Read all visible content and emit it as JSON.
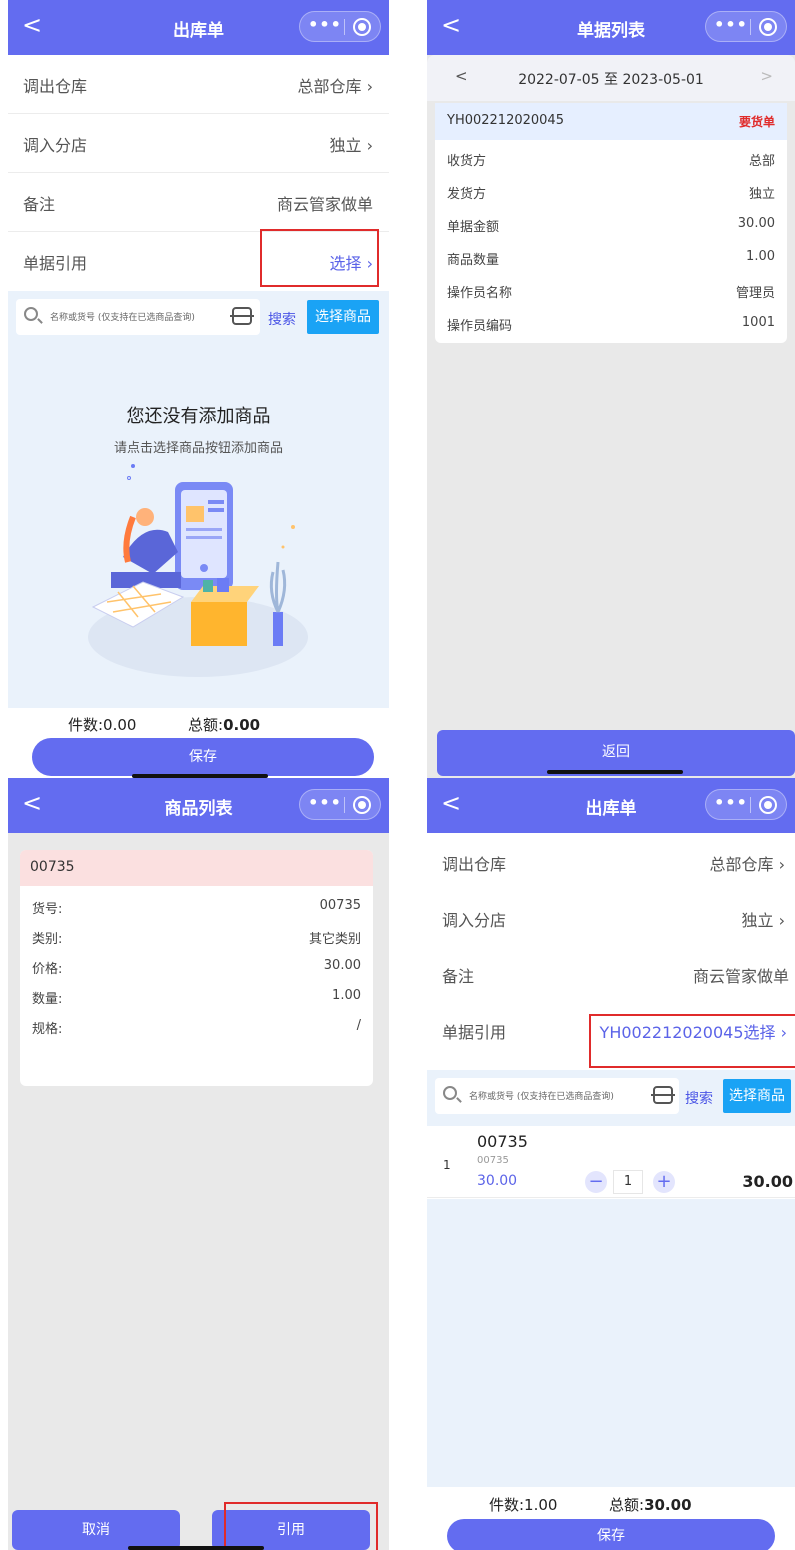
{
  "common": {
    "back_glyph": "<",
    "capsule_dots": "•••",
    "arrow": "›",
    "search_placeholder": "名称或货号 (仅支持在已选商品查询)",
    "search_label": "搜索",
    "pick_goods_label": "选择商品",
    "save_label": "保存",
    "accent_color": "#636cf0",
    "pick_color": "#1aa3f5",
    "highlight_box_color": "#e02b2b"
  },
  "outbound_empty": {
    "title": "出库单",
    "rows": [
      {
        "label": "调出仓库",
        "value": "总部仓库 ›"
      },
      {
        "label": "调入分店",
        "value": "独立 ›"
      },
      {
        "label": "备注",
        "value": "商云管家做单"
      },
      {
        "label": "单据引用",
        "value": "选择 ›"
      }
    ],
    "empty_title": "您还没有添加商品",
    "empty_hint": "请点击选择商品按钮添加商品",
    "count_label": "件数:0.00",
    "total_label": "总额:",
    "total_value": "0.00"
  },
  "doc_list": {
    "title": "单据列表",
    "date_range": "2022-07-05 至 2023-05-01",
    "prev_glyph": "<",
    "next_glyph": ">",
    "doc_no": "YH002212020045",
    "doc_type": "要货单",
    "fields": [
      {
        "k": "收货方",
        "v": "总部"
      },
      {
        "k": "发货方",
        "v": "独立"
      },
      {
        "k": "单据金额",
        "v": "30.00"
      },
      {
        "k": "商品数量",
        "v": "1.00"
      },
      {
        "k": "操作员名称",
        "v": "管理员"
      },
      {
        "k": "操作员编码",
        "v": "1001"
      }
    ],
    "back_label": "返回"
  },
  "goods_list": {
    "title": "商品列表",
    "item_code": "00735",
    "fields": [
      {
        "k": "货号:",
        "v": "00735"
      },
      {
        "k": "类别:",
        "v": "其它类别"
      },
      {
        "k": "价格:",
        "v": "30.00"
      },
      {
        "k": "数量:",
        "v": "1.00"
      },
      {
        "k": "规格:",
        "v": "/"
      }
    ],
    "cancel_label": "取消",
    "quote_label": "引用"
  },
  "outbound_filled": {
    "title": "出库单",
    "rows": [
      {
        "label": "调出仓库",
        "value": "总部仓库 ›"
      },
      {
        "label": "调入分店",
        "value": "独立 ›"
      },
      {
        "label": "备注",
        "value": "商云管家做单"
      },
      {
        "label": "单据引用",
        "value": "YH002212020045选择 ›"
      }
    ],
    "line": {
      "index": "1",
      "name": "00735",
      "code": "00735",
      "price": "30.00",
      "qty": "1",
      "minus": "−",
      "plus": "+",
      "subtotal": "30.00"
    },
    "count_label": "件数:1.00",
    "total_label": "总额:",
    "total_value": "30.00"
  }
}
